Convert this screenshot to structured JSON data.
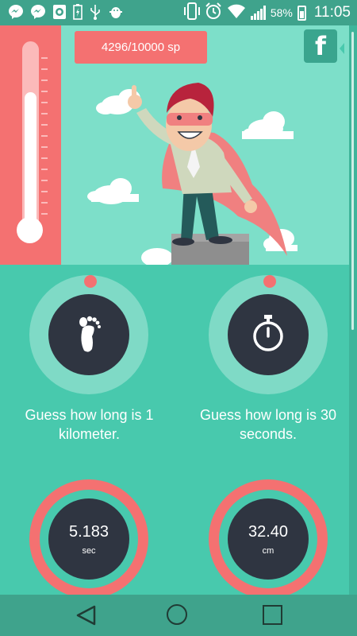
{
  "status_bar": {
    "notification_icons": [
      "messenger-icon",
      "messenger-icon",
      "camera-icon",
      "battery-charge-icon",
      "usb-icon",
      "android-debug-icon"
    ],
    "battery_percent": "58%",
    "time": "11:05"
  },
  "hero": {
    "steps_label": "4296/10000 sp",
    "progress_fraction": 0.4296,
    "facebook_label": "f"
  },
  "tiles": [
    {
      "icon": "footprint-icon",
      "caption": "Guess how long is 1 kilometer."
    },
    {
      "icon": "stopwatch-icon",
      "caption": "Guess how long is 30 seconds."
    }
  ],
  "results": [
    {
      "value": "5.183",
      "unit": "sec"
    },
    {
      "value": "32.40",
      "unit": "cm"
    }
  ],
  "nav": {
    "back": "back-icon",
    "home": "home-icon",
    "recent": "recent-apps-icon"
  },
  "colors": {
    "accent_red": "#f47171",
    "teal_bg": "#48c9ad",
    "hero_bg": "#7ddfc9",
    "dark_circle": "#2f3541"
  }
}
